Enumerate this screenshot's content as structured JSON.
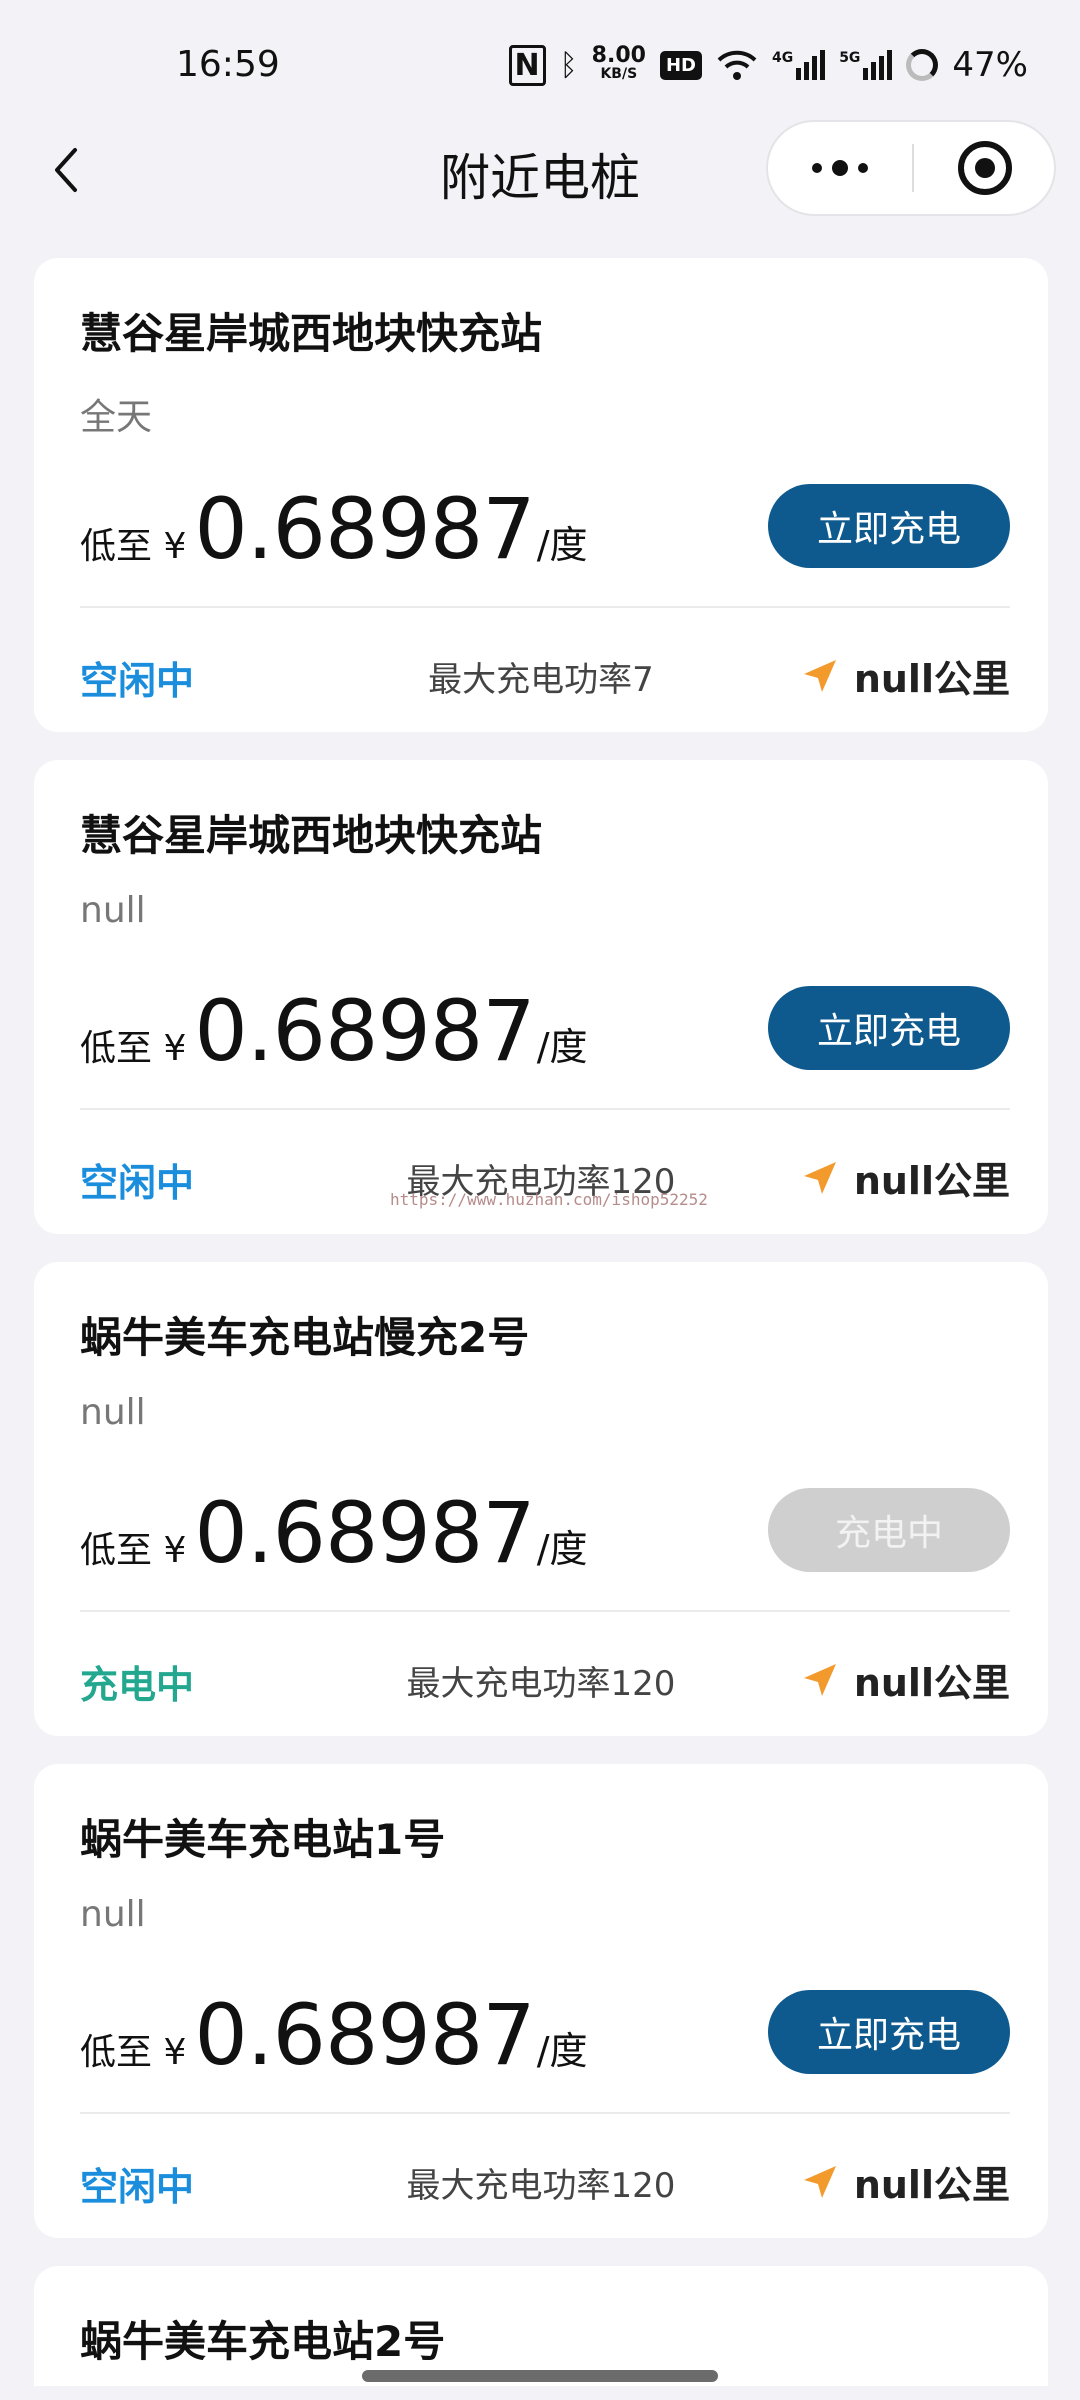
{
  "status_bar": {
    "time": "16:59",
    "speed_value": "8.00",
    "speed_unit": "KB/S",
    "hd_label": "HD",
    "net_4g": "4G",
    "net_5g": "5G",
    "battery": "47%"
  },
  "header": {
    "title": "附近电桩"
  },
  "stations": [
    {
      "name": "慧谷星岸城西地块快充站",
      "hours": "全天",
      "price_prefix": "低至 ¥",
      "price": "0.68987",
      "price_unit": "/度",
      "button": "立即充电",
      "status": "空闲中",
      "power": "最大充电功率7",
      "distance": "null公里"
    },
    {
      "name": "慧谷星岸城西地块快充站",
      "hours": "null",
      "price_prefix": "低至 ¥",
      "price": "0.68987",
      "price_unit": "/度",
      "button": "立即充电",
      "status": "空闲中",
      "power": "最大充电功率120",
      "distance": "null公里"
    },
    {
      "name": "蜗牛美车充电站慢充2号",
      "hours": "null",
      "price_prefix": "低至 ¥",
      "price": "0.68987",
      "price_unit": "/度",
      "button": "充电中",
      "status": "充电中",
      "power": "最大充电功率120",
      "distance": "null公里"
    },
    {
      "name": "蜗牛美车充电站1号",
      "hours": "null",
      "price_prefix": "低至 ¥",
      "price": "0.68987",
      "price_unit": "/度",
      "button": "立即充电",
      "status": "空闲中",
      "power": "最大充电功率120",
      "distance": "null公里"
    },
    {
      "name": "蜗牛美车充电站2号"
    }
  ],
  "watermark": "https://www.huzhan.com/ishop52252",
  "colors": {
    "primary_button": "#0e5a8e",
    "idle_status": "#1a8ddd",
    "charging_status": "#23a78f",
    "nav_arrow": "#f39a2c"
  }
}
